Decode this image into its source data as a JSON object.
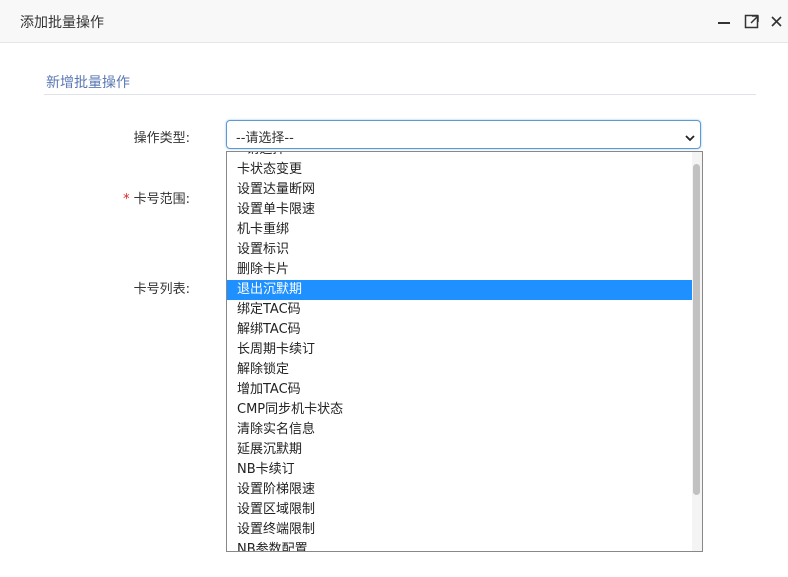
{
  "dialog": {
    "title": "添加批量操作"
  },
  "section": {
    "title": "新增批量操作"
  },
  "form": {
    "type_label": "操作类型:",
    "range_required_mark": "*",
    "range_label": "卡号范围:",
    "list_label": "卡号列表:",
    "select_value": "--请选择--"
  },
  "dropdown": {
    "options": [
      "--请选择--",
      "卡状态变更",
      "设置达量断网",
      "设置单卡限速",
      "机卡重绑",
      "设置标识",
      "删除卡片",
      "退出沉默期",
      "绑定TAC码",
      "解绑TAC码",
      "长周期卡续订",
      "解除锁定",
      "增加TAC码",
      "CMP同步机卡状态",
      "清除实名信息",
      "延展沉默期",
      "NB卡续订",
      "设置阶梯限速",
      "设置区域限制",
      "设置终端限制",
      "NB参数配置"
    ],
    "highlighted": "退出沉默期"
  },
  "colors": {
    "accent": "#1e90ff",
    "section_title": "#5a78b4",
    "required": "#e02020"
  }
}
